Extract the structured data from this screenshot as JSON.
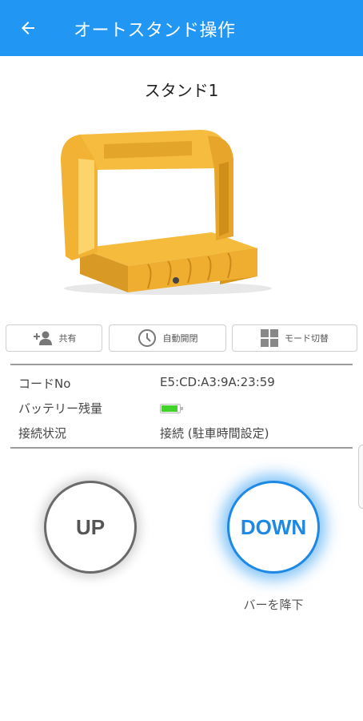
{
  "header": {
    "title": "オートスタンド操作",
    "back_icon": "arrow-left-icon",
    "color": "#2196f3"
  },
  "stand": {
    "name": "スタンド1",
    "image": "parking-lock-barrier-image",
    "image_color": "#f2b233"
  },
  "actions": [
    {
      "label": "共有",
      "icon": "add-person-icon"
    },
    {
      "label": "自動開閉",
      "icon": "clock-icon"
    },
    {
      "label": "モード切替",
      "icon": "grid-icon"
    }
  ],
  "info": {
    "code_label": "コードNo",
    "code_value": "E5:CD:A3:9A:23:59",
    "battery_label": "バッテリー残量",
    "battery_level": 0.9,
    "battery_color": "#43d12b",
    "connection_label": "接続状況",
    "connection_value": "接続 (駐車時間設定)"
  },
  "controls": {
    "up_label": "UP",
    "down_label": "DOWN",
    "status": "バーを降下",
    "active_color": "#1e88e5"
  }
}
